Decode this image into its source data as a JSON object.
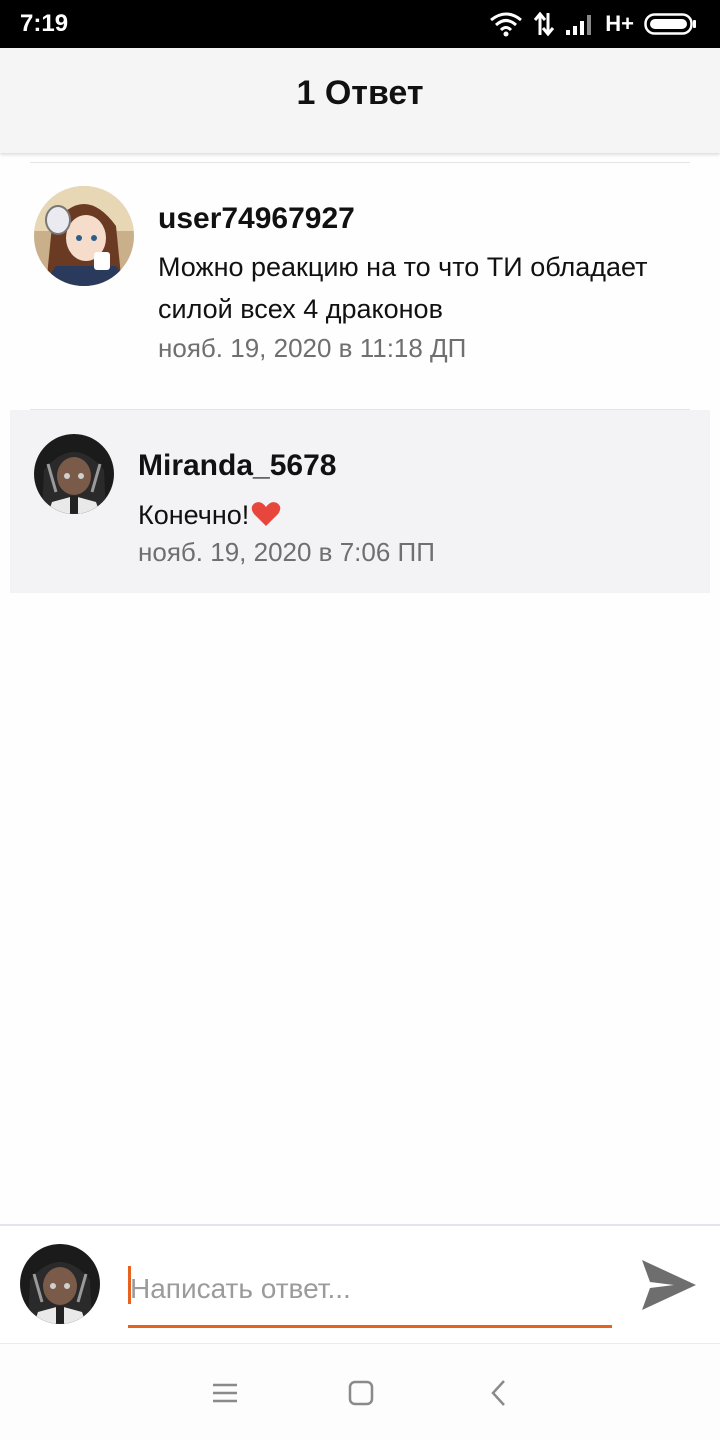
{
  "status_bar": {
    "time": "7:19",
    "network": "H+",
    "icons": [
      "wifi-icon",
      "data-transfer-icon",
      "signal-icon",
      "battery-icon"
    ]
  },
  "header": {
    "title": "1 Ответ"
  },
  "comments": [
    {
      "username": "user74967927",
      "text": "Можно реакцию на то что ТИ обладает силой всех 4 драконов",
      "date": "нояб. 19, 2020 в 11:18 ДП"
    },
    {
      "username": "Miranda_5678",
      "text": "Конечно!",
      "emoji": "heart-icon",
      "date": "нояб. 19, 2020 в 7:06 ПП"
    }
  ],
  "compose": {
    "placeholder": "Написать ответ...",
    "send_icon": "send-icon"
  },
  "nav_bar": {
    "icons": [
      "menu-icon",
      "home-icon",
      "back-icon"
    ]
  },
  "colors": {
    "accent": "#e8621f",
    "header_bg": "#f5f5f5",
    "highlight_bg": "#f3f3f6",
    "date_text": "#6f6f6f"
  }
}
